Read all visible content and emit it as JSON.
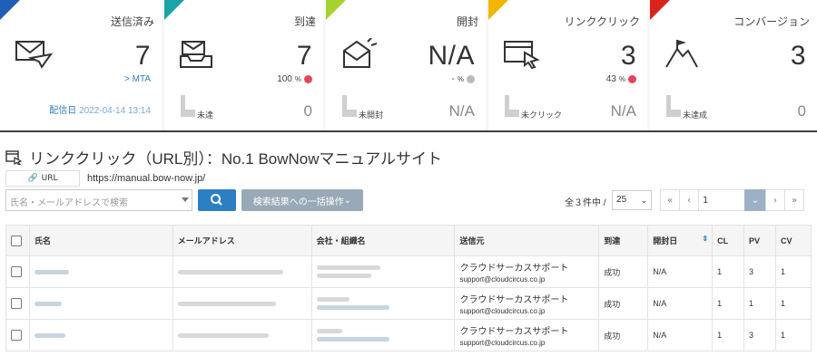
{
  "stats": [
    {
      "title": "送信済み",
      "value": "7",
      "link": "MTA",
      "sent_label": "配信日",
      "sent_date": "2022-04-14 13:14",
      "color": "#1f5fb5",
      "icon": "envelope-send-icon"
    },
    {
      "title": "到達",
      "value": "7",
      "percent": "100",
      "percent_unit": "%",
      "bottom_label": "未達",
      "bottom_value": "0",
      "color": "#1ba3a8",
      "icon": "inbox-icon"
    },
    {
      "title": "開封",
      "value": "N/A",
      "percent": "-",
      "percent_unit": "%",
      "bottom_label": "未開封",
      "bottom_value": "N/A",
      "color": "#a6d22f",
      "icon": "open-envelope-icon"
    },
    {
      "title": "リンククリック",
      "value": "3",
      "percent": "43",
      "percent_unit": "%",
      "bottom_label": "未クリック",
      "bottom_value": "N/A",
      "color": "#f2b600",
      "icon": "click-window-icon"
    },
    {
      "title": "コンバージョン",
      "value": "3",
      "bottom_label": "未達成",
      "bottom_value": "0",
      "color": "#d9231d",
      "icon": "mountain-flag-icon"
    }
  ],
  "page": {
    "title": "リンククリック（URL別）：No.1 BowNowマニュアルサイト",
    "url_badge": "URL",
    "url": "https://manual.bow-now.jp/"
  },
  "search": {
    "placeholder": "氏名・メールアドレスで検索",
    "bulk_label": "検索結果への一括操作"
  },
  "pagination": {
    "count_label": "全３件中 /",
    "per_page": "25",
    "current_page": "1",
    "first": "«",
    "prev": "‹",
    "next": "›",
    "last": "»"
  },
  "table": {
    "headers": [
      "氏名",
      "メールアドレス",
      "会社・組織名",
      "送信元",
      "到達",
      "開封日",
      "CL",
      "PV",
      "CV"
    ],
    "rows": [
      {
        "sender_name": "クラウドサーカスサポート",
        "sender_email": "support@cloudcircus.co.jp",
        "reach": "成功",
        "open_date": "N/A",
        "cl": "1",
        "pv": "3",
        "cv": "1"
      },
      {
        "sender_name": "クラウドサーカスサポート",
        "sender_email": "support@cloudcircus.co.jp",
        "reach": "成功",
        "open_date": "N/A",
        "cl": "1",
        "pv": "1",
        "cv": "1"
      },
      {
        "sender_name": "クラウドサーカスサポート",
        "sender_email": "support@cloudcircus.co.jp",
        "reach": "成功",
        "open_date": "N/A",
        "cl": "1",
        "pv": "3",
        "cv": "1"
      }
    ]
  }
}
